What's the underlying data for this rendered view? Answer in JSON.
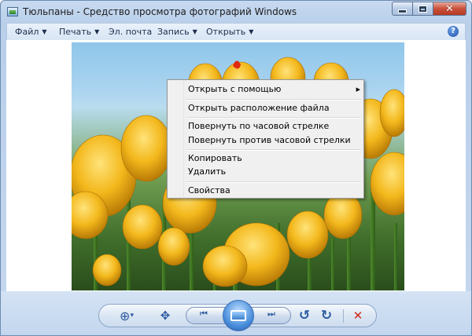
{
  "window": {
    "title": "Тюльпаны - Средство просмотра фотографий Windows",
    "app_icon": "photo-viewer-icon"
  },
  "menubar": {
    "items": [
      {
        "label": "Файл",
        "has_arrow": true
      },
      {
        "label": "Печать",
        "has_arrow": true
      },
      {
        "label": "Эл. почта",
        "has_arrow": false
      },
      {
        "label": "Запись",
        "has_arrow": true
      },
      {
        "label": "Открыть",
        "has_arrow": true
      }
    ],
    "arrow_glyph": "▼",
    "help_glyph": "?"
  },
  "context_menu": {
    "items": [
      {
        "label": "Открыть с помощью",
        "submenu": true
      },
      {
        "label": "Открыть расположение файла"
      },
      {
        "label": "Повернуть по часовой стрелке"
      },
      {
        "label": "Повернуть против часовой стрелки"
      },
      {
        "label": "Копировать"
      },
      {
        "label": "Удалить"
      },
      {
        "label": "Свойства"
      }
    ],
    "submenu_glyph": "▶"
  },
  "controls": {
    "zoom_glyph": "⊕",
    "zoom_arrow": "▾",
    "fit_glyph": "✥",
    "prev_glyph": "⏮",
    "next_glyph": "⏭",
    "rotate_ccw_glyph": "↺",
    "rotate_cw_glyph": "↻",
    "delete_glyph": "✕"
  },
  "colors": {
    "delete": "#d0281c",
    "accent": "#2c5aa0"
  }
}
